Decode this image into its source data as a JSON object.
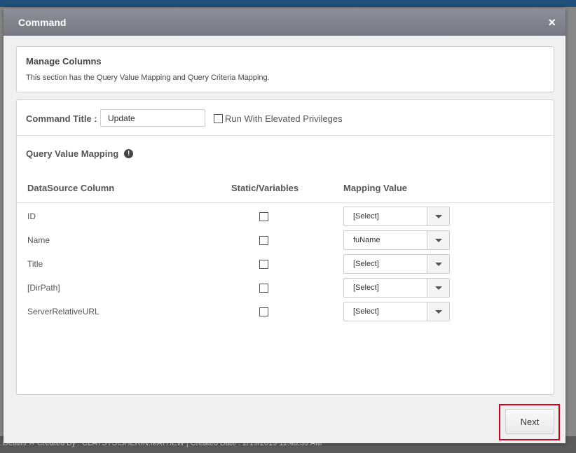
{
  "dialog": {
    "title": "Command",
    "close": "×",
    "manage": {
      "heading": "Manage Columns",
      "description": "This section has the Query Value Mapping and Query Criteria Mapping."
    },
    "command_title_label": "Command Title :",
    "command_title_value": "Update",
    "elevated_label": "Run With Elevated Privileges",
    "qvm_label": "Query Value Mapping",
    "info_icon": "!",
    "columns": [
      "DataSource Column",
      "Static/Variables",
      "Mapping Value"
    ],
    "rows": [
      {
        "column": "ID",
        "mapping": "[Select]"
      },
      {
        "column": "Name",
        "mapping": "fuName"
      },
      {
        "column": "Title",
        "mapping": "[Select]"
      },
      {
        "column": "[DirPath]",
        "mapping": "[Select]"
      },
      {
        "column": "ServerRelativeURL",
        "mapping": "[Select]"
      }
    ],
    "next_label": "Next"
  },
  "background": {
    "footer_text": "Details ✕   Created By : CLAYSYS\\SHERIN.MATHEW | Created Date : 2/19/2019 11:43:39 AM"
  }
}
